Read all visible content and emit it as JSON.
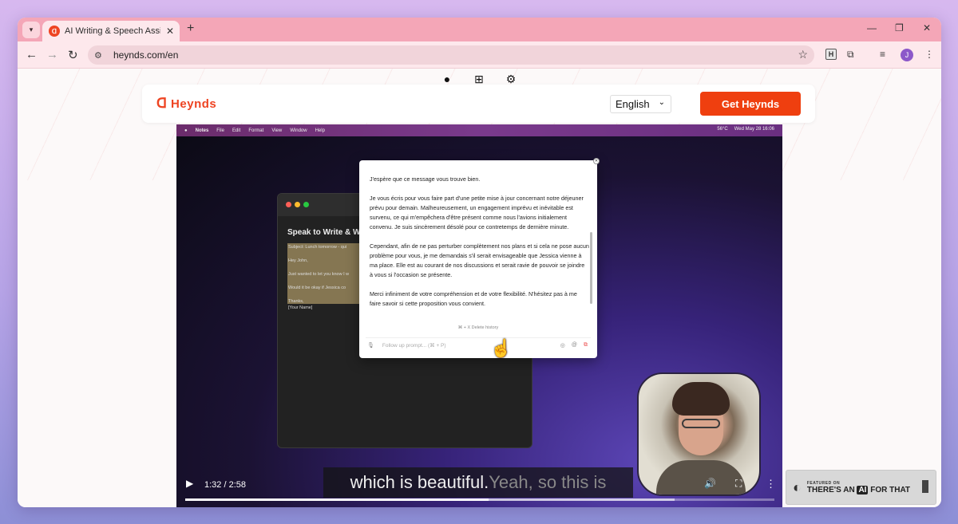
{
  "browser": {
    "tab_title": "AI Writing & Speech Assistant D",
    "url": "heynds.com/en",
    "profile_initial": "J",
    "extension_letter": "H"
  },
  "site": {
    "logo_text": "Heynds",
    "language": "English",
    "cta_label": "Get Heynds",
    "accent_color": "#ef3f0f"
  },
  "video": {
    "mac_menu": [
      "Notes",
      "File",
      "Edit",
      "Format",
      "View",
      "Window",
      "Help"
    ],
    "mac_status": [
      "56°C",
      "Wed May 28  16:06"
    ],
    "notes": {
      "title": "Speak to Write & W",
      "lines": [
        "Subject: Lunch tomorrow - qui",
        "Hey John,",
        "Just wanted to let you know I w",
        "Would it be okay if Jessica co",
        "Thanks,",
        "[Your Name]"
      ]
    },
    "chat": {
      "paragraphs": [
        "J'espère que ce message vous trouve bien.",
        "Je vous écris pour vous faire part d'une petite mise à jour concernant notre déjeuner prévu pour demain. Malheureusement, un engagement imprévu et inévitable est survenu, ce qui m'empêchera d'être présent comme nous l'avions initialement convenu. Je suis sincèrement désolé pour ce contretemps de dernière minute.",
        "Cependant, afin de ne pas perturber complètement nos plans et si cela ne pose aucun problème pour vous, je me demandais s'il serait envisageable que Jessica vienne à ma place. Elle est au courant de nos discussions et serait ravie de pouvoir se joindre à vous si l'occasion se présente.",
        "Merci infiniment de votre compréhension et de votre flexibilité. N'hésitez pas à me faire savoir si cette proposition vous convient."
      ],
      "hint": "⌘ + X  Delete history",
      "input_placeholder": "Follow up prompt... (⌘ + P)"
    },
    "caption_bright": "which is beautiful.",
    "caption_dim": " Yeah, so this is",
    "time": "1:32 / 2:58",
    "progress_fraction": 0.515,
    "buffered_fraction": 0.83
  },
  "badge": {
    "small": "FEATURED ON",
    "prefix": "THERE'S AN ",
    "ai": "AI",
    "suffix": " FOR THAT"
  }
}
